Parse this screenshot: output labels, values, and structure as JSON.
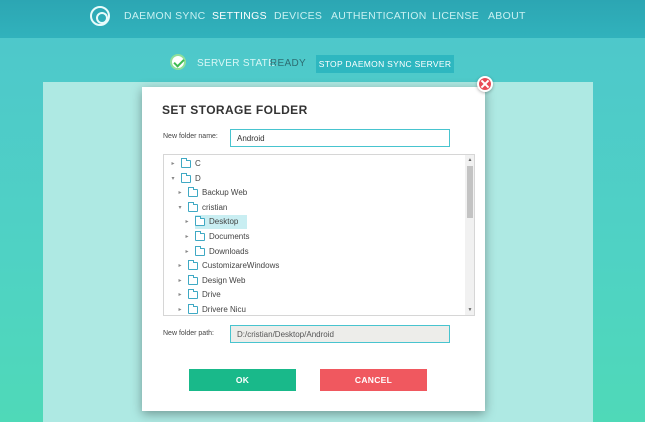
{
  "nav": {
    "brand_icon": "target-logo-icon",
    "items": [
      {
        "label": "DAEMON SYNC",
        "active": false
      },
      {
        "label": "SETTINGS",
        "active": true
      },
      {
        "label": "DEVICES",
        "active": false
      },
      {
        "label": "AUTHENTICATION",
        "active": false
      },
      {
        "label": "LICENSE",
        "active": false
      },
      {
        "label": "ABOUT",
        "active": false
      }
    ]
  },
  "server": {
    "state_label": "SERVER STATE:",
    "state_value": "READY",
    "stop_button": "STOP DAEMON SYNC SERVER"
  },
  "dialog": {
    "title": "SET STORAGE FOLDER",
    "name_label": "New folder name:",
    "name_value": "Android",
    "path_label": "New folder path:",
    "path_value": "D:/cristian/Desktop/Android",
    "ok_label": "OK",
    "cancel_label": "CANCEL",
    "tree": [
      {
        "label": "C",
        "level": 0,
        "expanded": false
      },
      {
        "label": "D",
        "level": 0,
        "expanded": true
      },
      {
        "label": "Backup Web",
        "level": 1,
        "expanded": false
      },
      {
        "label": "cristian",
        "level": 1,
        "expanded": true
      },
      {
        "label": "Desktop",
        "level": 2,
        "expanded": false,
        "selected": true
      },
      {
        "label": "Documents",
        "level": 2,
        "expanded": false
      },
      {
        "label": "Downloads",
        "level": 2,
        "expanded": false
      },
      {
        "label": "CustomizareWindows",
        "level": 1,
        "expanded": false
      },
      {
        "label": "Design Web",
        "level": 1,
        "expanded": false
      },
      {
        "label": "Drive",
        "level": 1,
        "expanded": false
      },
      {
        "label": "Drivere Nicu",
        "level": 1,
        "expanded": false
      }
    ]
  },
  "colors": {
    "accent": "#2eb7c0",
    "ok": "#19b98a",
    "cancel": "#f0585f",
    "selected_row": "#c9eef2"
  }
}
